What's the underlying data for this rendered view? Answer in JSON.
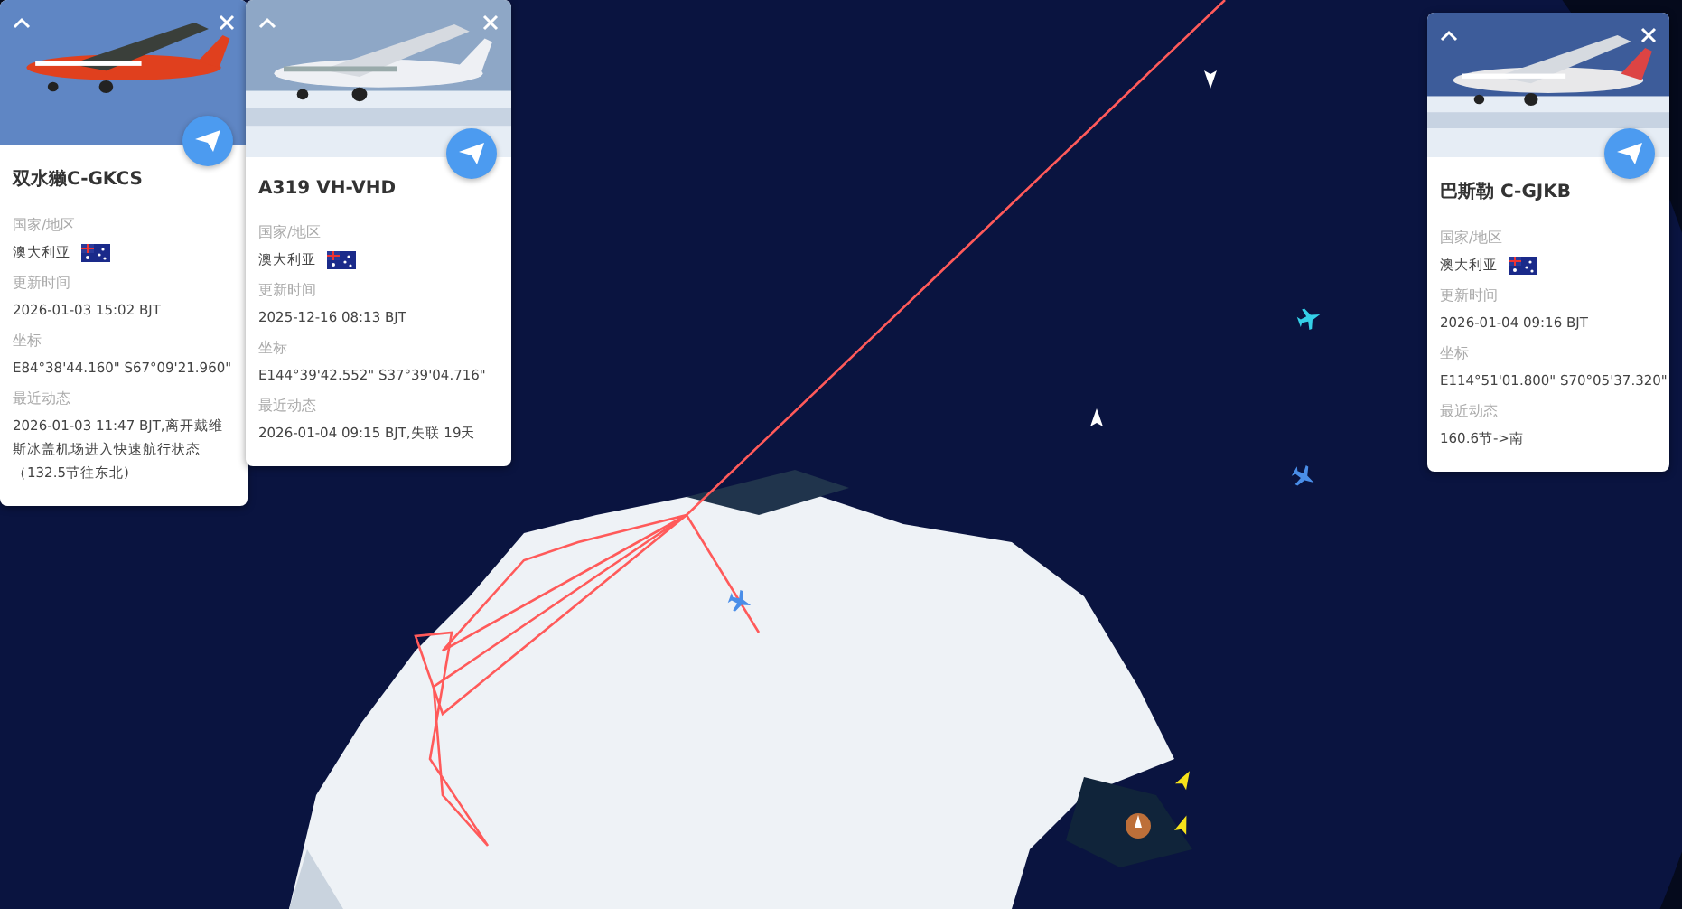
{
  "cards": [
    {
      "title": "双水獭C-GKCS",
      "fields": [
        {
          "label": "国家/地区",
          "value": "澳大利亚",
          "flag": true
        },
        {
          "label": "更新时间",
          "value": "2026-01-03 15:02 BJT"
        },
        {
          "label": "坐标",
          "value": "E84°38'44.160\" S67°09'21.960\""
        },
        {
          "label": "最近动态",
          "value": "2026-01-03 11:47 BJT,离开戴维斯冰盖机场进入快速航行状态（132.5节往东北)"
        }
      ]
    },
    {
      "title": "A319 VH-VHD",
      "fields": [
        {
          "label": "国家/地区",
          "value": "澳大利亚",
          "flag": true
        },
        {
          "label": "更新时间",
          "value": "2025-12-16 08:13 BJT"
        },
        {
          "label": "坐标",
          "value": "E144°39'42.552\" S37°39'04.716\""
        },
        {
          "label": "最近动态",
          "value": "2026-01-04 09:15 BJT,失联 19天"
        }
      ]
    },
    {
      "title": "巴斯勒 C-GJKB",
      "fields": [
        {
          "label": "国家/地区",
          "value": "澳大利亚",
          "flag": true
        },
        {
          "label": "更新时间",
          "value": "2026-01-04 09:16 BJT"
        },
        {
          "label": "坐标",
          "value": "E114°51'01.800\" S70°05'37.320\""
        },
        {
          "label": "最近动态",
          "value": "160.6节->南"
        }
      ]
    }
  ]
}
